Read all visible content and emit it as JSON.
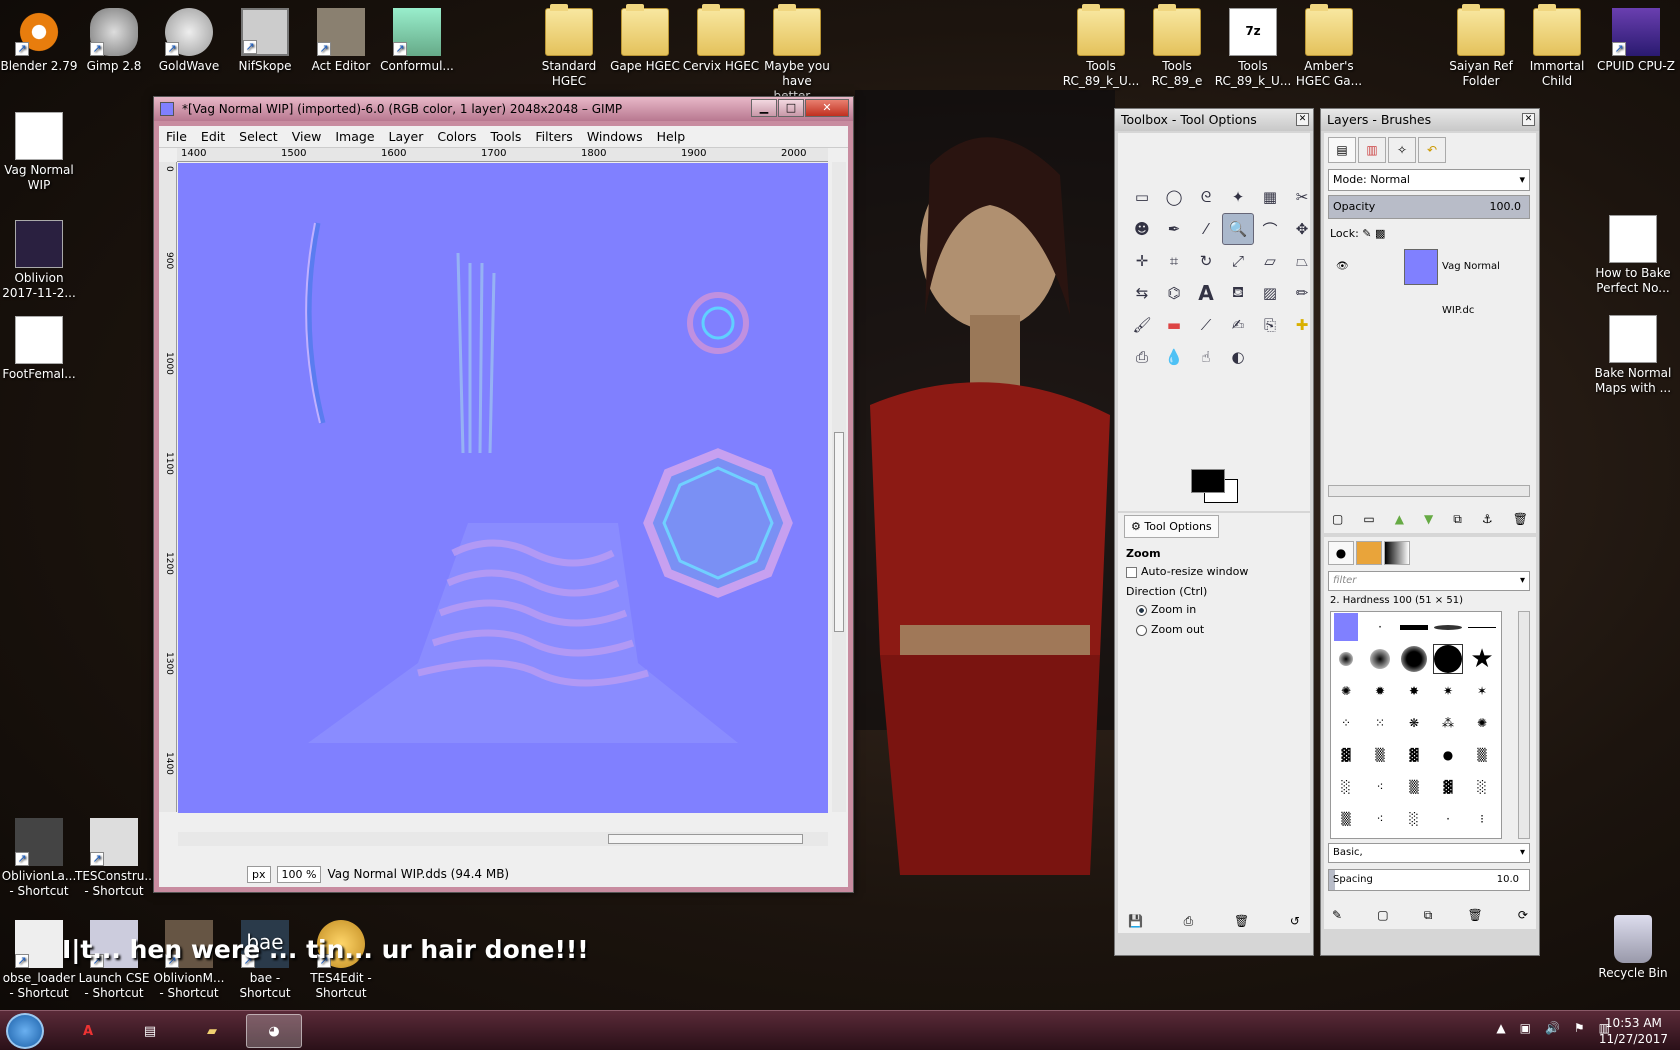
{
  "desktop_left": [
    {
      "label": "Blender 2.79",
      "icon": "blender-icon"
    },
    {
      "label": "Gimp 2.8",
      "icon": "gimp-icon"
    },
    {
      "label": "GoldWave",
      "icon": "goldwave-icon"
    },
    {
      "label": "NifSkope",
      "icon": "nifskope-icon"
    },
    {
      "label": "Act Editor",
      "icon": "act-editor-icon"
    },
    {
      "label": "Conformul...",
      "icon": "conformulator-icon"
    },
    {
      "label": "Vag Normal WIP",
      "icon": "gimp-file-icon"
    },
    {
      "label": "Oblivion 2017-11-2...",
      "icon": "oblivion-image-icon"
    },
    {
      "label": "FootFemal...",
      "icon": "gimp-file-icon"
    }
  ],
  "desktop_folders": [
    {
      "label": "Standard HGEC",
      "icon": "folder-icon"
    },
    {
      "label": "Gape HGEC",
      "icon": "folder-icon"
    },
    {
      "label": "Cervix HGEC",
      "icon": "folder-icon"
    },
    {
      "label": "Maybe you have better...",
      "icon": "folder-icon"
    },
    {
      "label": "Tools RC_89_k_U...",
      "icon": "folder-icon"
    },
    {
      "label": "Tools RC_89_e",
      "icon": "folder-icon"
    },
    {
      "label": "Tools RC_89_k_U...",
      "icon": "7z-archive-icon"
    },
    {
      "label": "Amber's HGEC Ga...",
      "icon": "folder-icon"
    },
    {
      "label": "Saiyan Ref Folder",
      "icon": "folder-icon"
    },
    {
      "label": "Immortal Child",
      "icon": "folder-icon"
    },
    {
      "label": "CPUID CPU-Z",
      "icon": "cpuz-icon"
    }
  ],
  "desktop_right": [
    {
      "label": "How to Bake Perfect No...",
      "icon": "video-file-icon"
    },
    {
      "label": "Bake Normal Maps with ...",
      "icon": "video-file-icon"
    },
    {
      "label": "Recycle Bin",
      "icon": "recycle-bin-icon"
    }
  ],
  "desktop_bottom": [
    {
      "label": "OblivionLa... - Shortcut"
    },
    {
      "label": "TESConstru... - Shortcut"
    },
    {
      "label": "obse_loader - Shortcut"
    },
    {
      "label": "Launch CSE - Shortcut"
    },
    {
      "label": "OblivionM... - Shortcut"
    },
    {
      "label": "bae - Shortcut"
    },
    {
      "label": "TES4Edit - Shortcut"
    }
  ],
  "subtitle": "I|t... hen were ... tin... ur hair done!!!",
  "gimp": {
    "title": "*[Vag Normal WIP] (imported)-6.0 (RGB color, 1 layer) 2048x2048 – GIMP",
    "menus": [
      "File",
      "Edit",
      "Select",
      "View",
      "Image",
      "Layer",
      "Colors",
      "Tools",
      "Filters",
      "Windows",
      "Help"
    ],
    "ruler_h": [
      "1400",
      "1500",
      "1600",
      "1700",
      "1800",
      "1900",
      "2000"
    ],
    "ruler_v": [
      "0",
      "900",
      "1000",
      "1100",
      "1200",
      "1300",
      "1400"
    ],
    "unit": "px",
    "zoom": "100 %",
    "status": "Vag Normal WIP.dds (94.4 MB)",
    "canvas_color": "#8080ff"
  },
  "toolbox": {
    "title": "Toolbox - Tool Options",
    "tools": [
      "rect-select",
      "ellipse-select",
      "free-select",
      "fuzzy-select",
      "color-select",
      "scissors",
      "foreground-select",
      "paths",
      "color-picker",
      "zoom",
      "measure",
      "move",
      "align",
      "crop",
      "rotate",
      "scale",
      "shear",
      "perspective",
      "flip",
      "cage",
      "text",
      "bucket-fill",
      "blend",
      "pencil",
      "paintbrush",
      "eraser",
      "airbrush",
      "ink",
      "clone",
      "heal",
      "perspective-clone",
      "blur",
      "smudge",
      "dodge"
    ],
    "tab_label": "Tool Options",
    "section": "Zoom",
    "auto_resize": "Auto-resize window",
    "direction_label": "Direction  (Ctrl)",
    "zoom_in": "Zoom in",
    "zoom_out": "Zoom out"
  },
  "layers": {
    "title": "Layers - Brushes",
    "mode_label": "Mode:",
    "mode_value": "Normal",
    "opacity_label": "Opacity",
    "opacity_value": "100.0",
    "lock_label": "Lock:",
    "layer_name": "Vag Normal WIP.dc",
    "filter_placeholder": "filter",
    "brush_name": "2. Hardness 100 (51 × 51)",
    "brush_tag": "Basic,",
    "spacing_label": "Spacing",
    "spacing_value": "10.0"
  },
  "taskbar": {
    "clock_time": "10:53 AM",
    "clock_date": "11/27/2017",
    "items": [
      "start",
      "120x",
      "monitor",
      "explorer",
      "gimp"
    ]
  }
}
